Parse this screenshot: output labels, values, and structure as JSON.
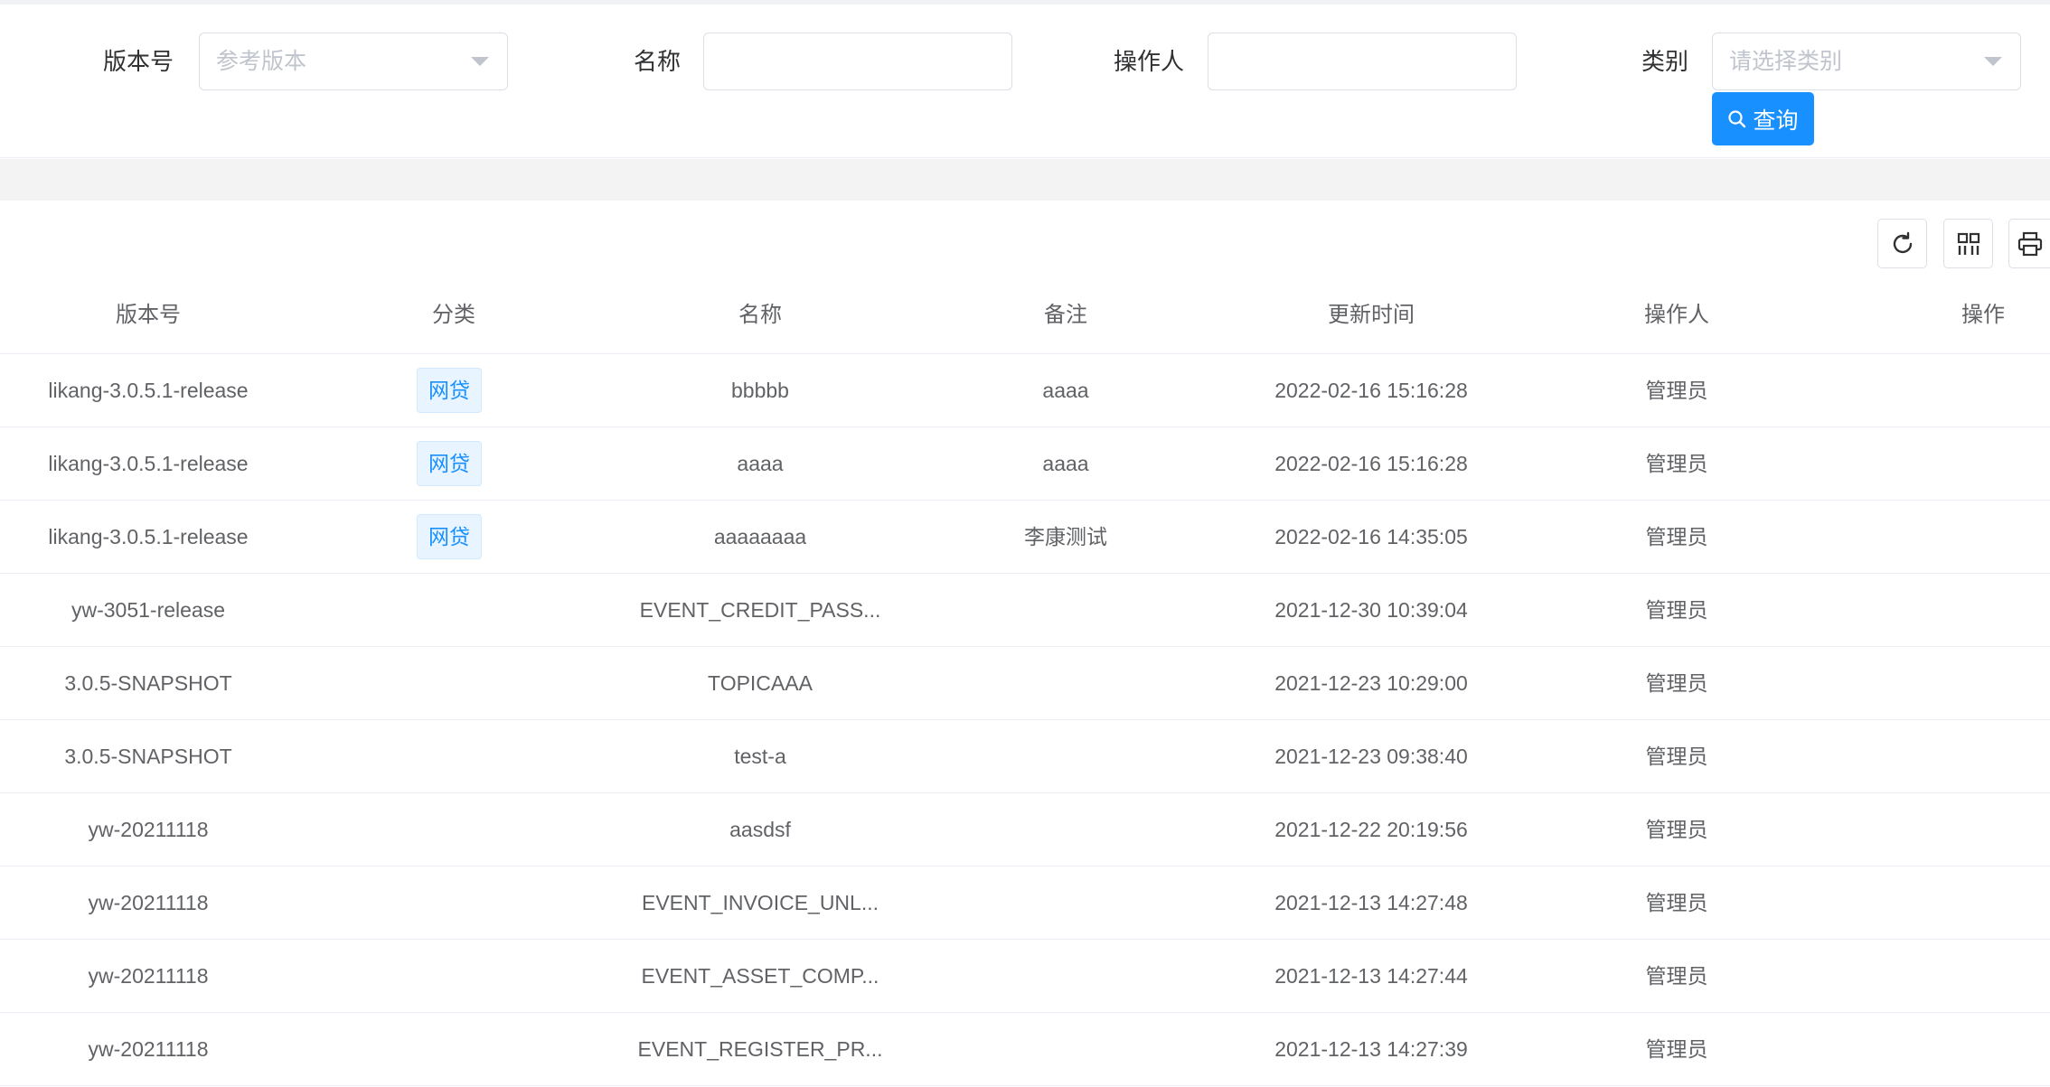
{
  "search_form": {
    "version_label": "版本号",
    "version_placeholder": "参考版本",
    "name_label": "名称",
    "name_value": "",
    "operator_label": "操作人",
    "operator_value": "",
    "category_label": "类别",
    "category_placeholder": "请选择类别",
    "query_button": "查询"
  },
  "toolbar": {
    "refresh_icon": "refresh-icon",
    "columns_icon": "columns-icon",
    "print_icon": "print-icon"
  },
  "table": {
    "columns": [
      "版本号",
      "分类",
      "名称",
      "备注",
      "更新时间",
      "操作人",
      "操作"
    ],
    "rows": [
      {
        "version": "likang-3.0.5.1-release",
        "category": "网贷",
        "name": "bbbbb",
        "remark": "aaaa",
        "updated": "2022-02-16 15:16:28",
        "operator": "管理员"
      },
      {
        "version": "likang-3.0.5.1-release",
        "category": "网贷",
        "name": "aaaa",
        "remark": "aaaa",
        "updated": "2022-02-16 15:16:28",
        "operator": "管理员"
      },
      {
        "version": "likang-3.0.5.1-release",
        "category": "网贷",
        "name": "aaaaaaaa",
        "remark": "李康测试",
        "updated": "2022-02-16 14:35:05",
        "operator": "管理员"
      },
      {
        "version": "yw-3051-release",
        "category": "",
        "name": "EVENT_CREDIT_PASS...",
        "remark": "",
        "updated": "2021-12-30 10:39:04",
        "operator": "管理员"
      },
      {
        "version": "3.0.5-SNAPSHOT",
        "category": "",
        "name": "TOPICAAA",
        "remark": "",
        "updated": "2021-12-23 10:29:00",
        "operator": "管理员"
      },
      {
        "version": "3.0.5-SNAPSHOT",
        "category": "",
        "name": "test-a",
        "remark": "",
        "updated": "2021-12-23 09:38:40",
        "operator": "管理员"
      },
      {
        "version": "yw-20211118",
        "category": "",
        "name": "aasdsf",
        "remark": "",
        "updated": "2021-12-22 20:19:56",
        "operator": "管理员"
      },
      {
        "version": "yw-20211118",
        "category": "",
        "name": "EVENT_INVOICE_UNL...",
        "remark": "",
        "updated": "2021-12-13 14:27:48",
        "operator": "管理员"
      },
      {
        "version": "yw-20211118",
        "category": "",
        "name": "EVENT_ASSET_COMP...",
        "remark": "",
        "updated": "2021-12-13 14:27:44",
        "operator": "管理员"
      },
      {
        "version": "yw-20211118",
        "category": "",
        "name": "EVENT_REGISTER_PR...",
        "remark": "",
        "updated": "2021-12-13 14:27:39",
        "operator": "管理员"
      }
    ]
  },
  "colors": {
    "primary": "#1890ff",
    "tag_bg": "#e8f4ff",
    "border": "#dcdfe6",
    "text": "#606266"
  }
}
